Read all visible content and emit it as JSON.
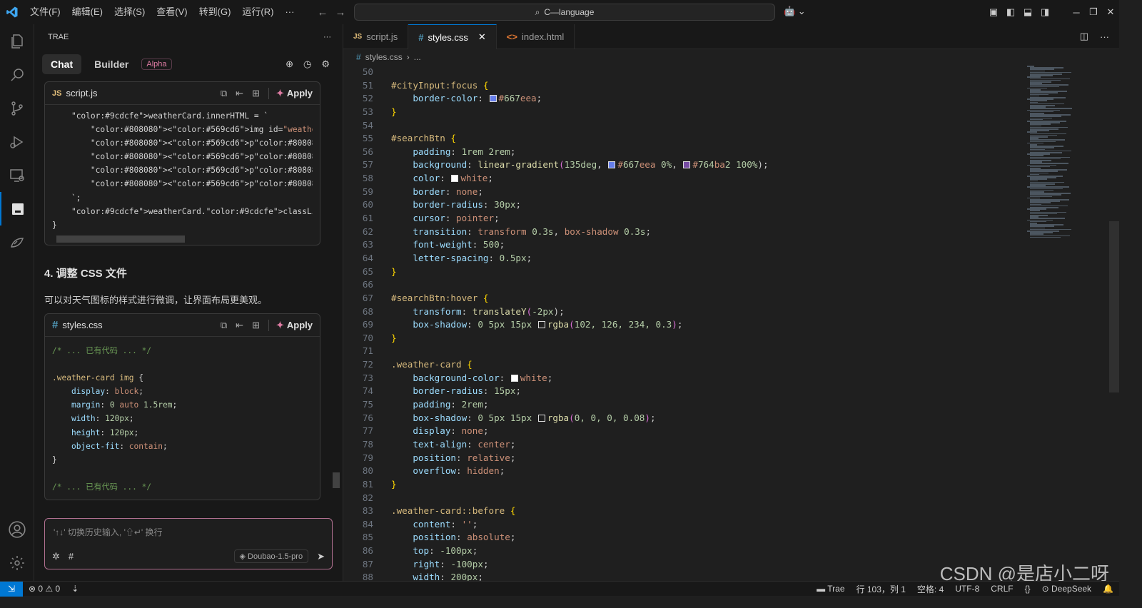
{
  "titlebar": {
    "menu": [
      "文件(F)",
      "编辑(E)",
      "选择(S)",
      "查看(V)",
      "转到(G)",
      "运行(R)",
      "···"
    ],
    "search": "C—language"
  },
  "panel": {
    "title": "TRAE",
    "tabs": {
      "chat": "Chat",
      "builder": "Builder",
      "alpha": "Alpha"
    },
    "block1": {
      "lang": "JS",
      "filename": "script.js",
      "apply": "Apply",
      "lines": [
        "    weatherCard.innerHTML = `",
        "        <img id=\"weatherIcon\" src=\"${weatherIcon.src}\" alt",
        "        <p>城市: ${data.name}</p>",
        "        <p>天气状况: ${weatherDescription}</p>",
        "        <p>温度: ${temperature}℃</p>",
        "        <p>风力: ${windDescription}</p>",
        "    `;",
        "    weatherCard.classList.add('show');",
        "}"
      ]
    },
    "heading": "4. 调整 CSS 文件",
    "paragraph": "可以对天气图标的样式进行微调，让界面布局更美观。",
    "block2": {
      "lang": "#",
      "filename": "styles.css",
      "apply": "Apply",
      "lines": [
        "/* ... 已有代码 ... */",
        "",
        ".weather-card img {",
        "    display: block;",
        "    margin: 0 auto 1.5rem;",
        "    width: 120px;",
        "    height: 120px;",
        "    object-fit: contain;",
        "}",
        "",
        "/* ... 已有代码 ... */"
      ]
    },
    "input": {
      "placeholder": "'↑↓' 切换历史输入, '⇧↵' 换行",
      "model": "Doubao-1.5-pro"
    }
  },
  "editor": {
    "tabs": [
      {
        "label": "script.js",
        "icon": "JS",
        "active": false
      },
      {
        "label": "styles.css",
        "icon": "#",
        "active": true
      },
      {
        "label": "index.html",
        "icon": "<>",
        "active": false
      }
    ],
    "breadcrumb": [
      "styles.css",
      "..."
    ],
    "colors": {
      "667eea": "#667eea",
      "764ba2": "#764ba2",
      "white": "#ffffff",
      "shadow1": "rgba(102,126,234,0.3)",
      "shadow2": "rgba(0,0,0,0.08)"
    },
    "lines": [
      {
        "n": "50",
        "code": ""
      },
      {
        "n": "51",
        "code": "#cityInput:focus {"
      },
      {
        "n": "52",
        "code": "    border-color: #667eea;"
      },
      {
        "n": "53",
        "code": "}"
      },
      {
        "n": "54",
        "code": ""
      },
      {
        "n": "55",
        "code": "#searchBtn {"
      },
      {
        "n": "56",
        "code": "    padding: 1rem 2rem;"
      },
      {
        "n": "57",
        "code": "    background: linear-gradient(135deg, #667eea 0%, #764ba2 100%);"
      },
      {
        "n": "58",
        "code": "    color: white;"
      },
      {
        "n": "59",
        "code": "    border: none;"
      },
      {
        "n": "60",
        "code": "    border-radius: 30px;"
      },
      {
        "n": "61",
        "code": "    cursor: pointer;"
      },
      {
        "n": "62",
        "code": "    transition: transform 0.3s, box-shadow 0.3s;"
      },
      {
        "n": "63",
        "code": "    font-weight: 500;"
      },
      {
        "n": "64",
        "code": "    letter-spacing: 0.5px;"
      },
      {
        "n": "65",
        "code": "}"
      },
      {
        "n": "66",
        "code": ""
      },
      {
        "n": "67",
        "code": "#searchBtn:hover {"
      },
      {
        "n": "68",
        "code": "    transform: translateY(-2px);"
      },
      {
        "n": "69",
        "code": "    box-shadow: 0 5px 15px rgba(102, 126, 234, 0.3);"
      },
      {
        "n": "70",
        "code": "}"
      },
      {
        "n": "71",
        "code": ""
      },
      {
        "n": "72",
        "code": ".weather-card {"
      },
      {
        "n": "73",
        "code": "    background-color: white;"
      },
      {
        "n": "74",
        "code": "    border-radius: 15px;"
      },
      {
        "n": "75",
        "code": "    padding: 2rem;"
      },
      {
        "n": "76",
        "code": "    box-shadow: 0 5px 15px rgba(0, 0, 0, 0.08);"
      },
      {
        "n": "77",
        "code": "    display: none;"
      },
      {
        "n": "78",
        "code": "    text-align: center;"
      },
      {
        "n": "79",
        "code": "    position: relative;"
      },
      {
        "n": "80",
        "code": "    overflow: hidden;"
      },
      {
        "n": "81",
        "code": "}"
      },
      {
        "n": "82",
        "code": ""
      },
      {
        "n": "83",
        "code": ".weather-card::before {"
      },
      {
        "n": "84",
        "code": "    content: '';"
      },
      {
        "n": "85",
        "code": "    position: absolute;"
      },
      {
        "n": "86",
        "code": "    top: -100px;"
      },
      {
        "n": "87",
        "code": "    right: -100px;"
      },
      {
        "n": "88",
        "code": "    width: 200px;"
      }
    ]
  },
  "statusbar": {
    "errors": "0",
    "warnings": "0",
    "brand": "Trae",
    "position": "行 103，列 1",
    "spaces": "空格: 4",
    "encoding": "UTF-8",
    "eol": "CRLF",
    "braces": "{}",
    "ai": "DeepSeek"
  },
  "watermark": "CSDN @是店小二呀"
}
